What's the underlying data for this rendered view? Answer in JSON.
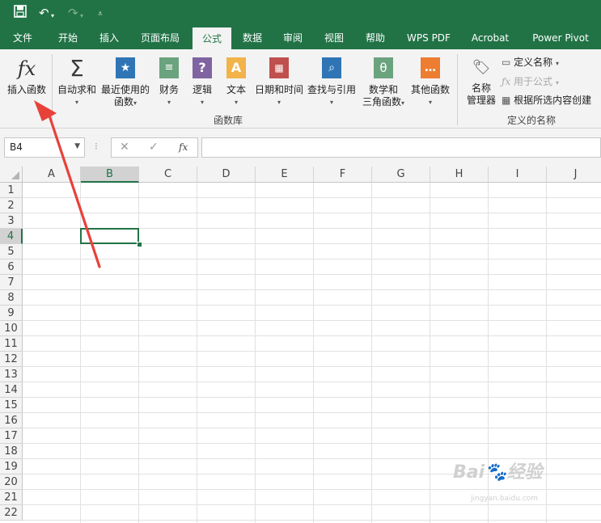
{
  "qat": {
    "save_icon": "save-icon",
    "undo_icon": "undo-icon",
    "redo_icon": "redo-icon",
    "customize_icon": "customize-icon"
  },
  "tabs": [
    {
      "label": "文件"
    },
    {
      "label": "开始"
    },
    {
      "label": "插入"
    },
    {
      "label": "页面布局"
    },
    {
      "label": "公式",
      "active": true
    },
    {
      "label": "数据"
    },
    {
      "label": "审阅"
    },
    {
      "label": "视图"
    },
    {
      "label": "帮助"
    },
    {
      "label": "WPS PDF"
    },
    {
      "label": "Acrobat"
    },
    {
      "label": "Power Pivot"
    }
  ],
  "ribbon": {
    "insert_function": {
      "icon_text": "fx",
      "label": "插入函数"
    },
    "autosum": {
      "label": "自动求和",
      "caret": "▾"
    },
    "recent": {
      "label1": "最近使用的",
      "label2": "函数",
      "caret": "▾"
    },
    "financial": {
      "label": "财务",
      "caret": "▾"
    },
    "logical": {
      "label": "逻辑",
      "caret": "▾"
    },
    "text": {
      "label": "文本",
      "caret": "▾"
    },
    "datetime": {
      "label": "日期和时间",
      "caret": "▾"
    },
    "lookup": {
      "label": "查找与引用",
      "caret": "▾"
    },
    "math": {
      "label1": "数学和",
      "label2": "三角函数",
      "caret": "▾"
    },
    "other": {
      "label": "其他函数",
      "caret": "▾"
    },
    "group_library": "函数库",
    "name_manager": {
      "label1": "名称",
      "label2": "管理器"
    },
    "define_name": {
      "label": "定义名称",
      "caret": "▾"
    },
    "use_in_formula": {
      "label": "用于公式",
      "caret": "▾"
    },
    "create_from_selection": {
      "label": "根据所选内容创建"
    },
    "group_names": "定义的名称",
    "colors": {
      "green": "#217346",
      "blue": "#2f75b5",
      "orange": "#ed7d31",
      "red": "#c0504d",
      "purple": "#8064a2",
      "teal": "#4aacc6",
      "sum": "#3a3a3a"
    }
  },
  "formula_bar": {
    "name_box": "B4",
    "cancel": "✕",
    "enter": "✓",
    "fx": "fx",
    "formula": ""
  },
  "grid": {
    "columns": [
      "A",
      "B",
      "C",
      "D",
      "E",
      "F",
      "G",
      "H",
      "I",
      "J"
    ],
    "rows": [
      "1",
      "2",
      "3",
      "4",
      "5",
      "6",
      "7",
      "8",
      "9",
      "10",
      "11",
      "12",
      "13",
      "14",
      "15",
      "16",
      "17",
      "18",
      "19",
      "20",
      "21",
      "22"
    ],
    "selected_col": "B",
    "selected_row": "4"
  },
  "watermark": {
    "text": "Bai🐾经验",
    "sub": "jingyan.baidu.com"
  }
}
